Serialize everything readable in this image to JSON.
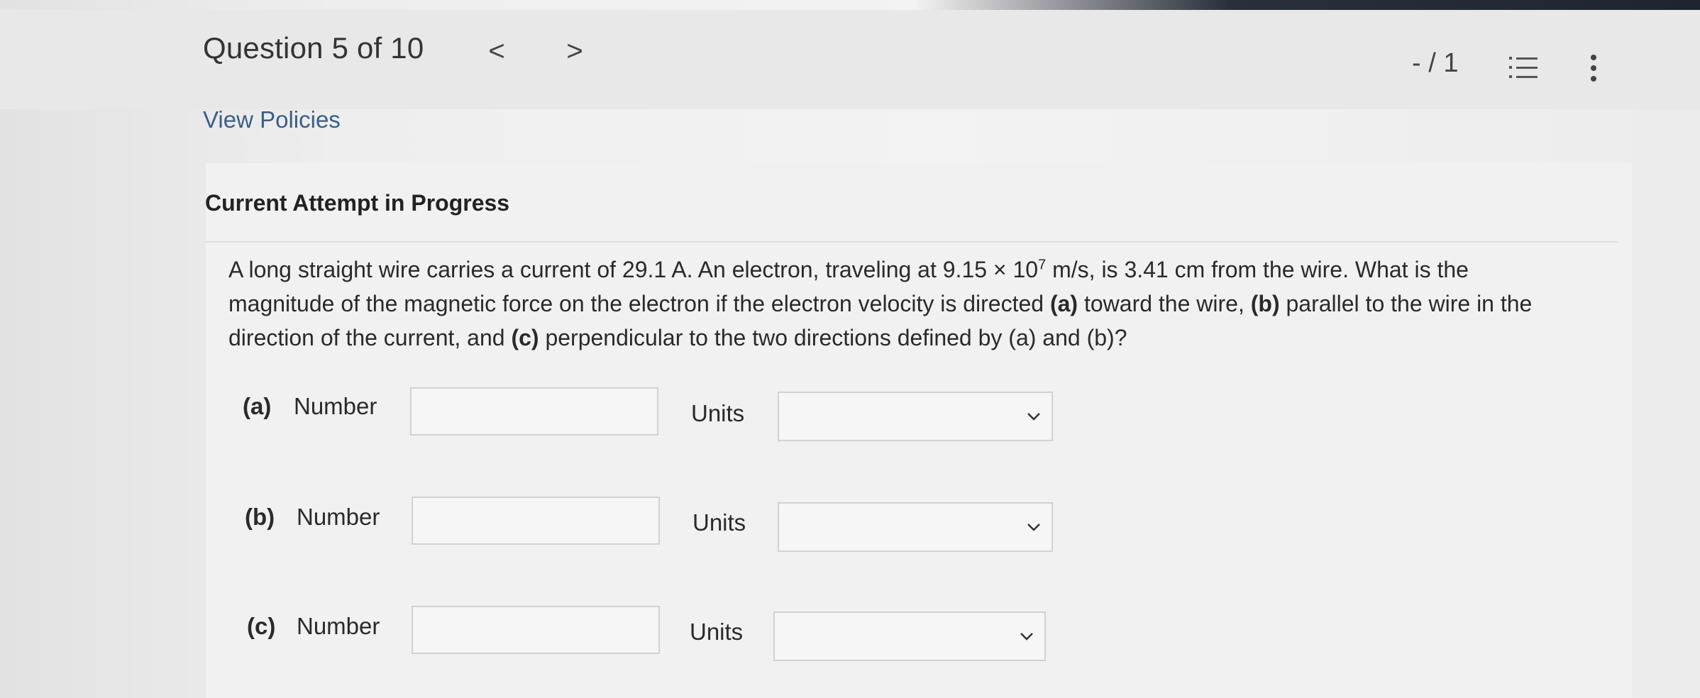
{
  "header": {
    "question_title": "Question 5 of 10",
    "prev_symbol": "<",
    "next_symbol": ">",
    "score": "- / 1"
  },
  "links": {
    "view_policies": "View Policies"
  },
  "attempt_status": "Current Attempt in Progress",
  "problem": {
    "text_1": "A long straight wire carries a current of 29.1 A. An electron, traveling at 9.15 × 10",
    "exponent": "7",
    "text_2": " m/s, is 3.41 cm from the wire. What is the magnitude of the magnetic force on the electron if the electron velocity is directed ",
    "part_a_tag": "(a)",
    "text_3": " toward the wire, ",
    "part_b_tag": "(b)",
    "text_4": " parallel to the wire in the direction of the current, and ",
    "part_c_tag": "(c)",
    "text_5": " perpendicular to the two directions defined by (a) and (b)?"
  },
  "parts": [
    {
      "label": "(a)",
      "number_label": "Number",
      "number_value": "",
      "units_label": "Units",
      "units_value": ""
    },
    {
      "label": "(b)",
      "number_label": "Number",
      "number_value": "",
      "units_label": "Units",
      "units_value": ""
    },
    {
      "label": "(c)",
      "number_label": "Number",
      "number_value": "",
      "units_label": "Units",
      "units_value": ""
    }
  ],
  "icons": {
    "question_list": "numbered-list-icon",
    "more_options": "vertical-ellipsis-icon",
    "select_arrow": "chevron-down-icon"
  }
}
